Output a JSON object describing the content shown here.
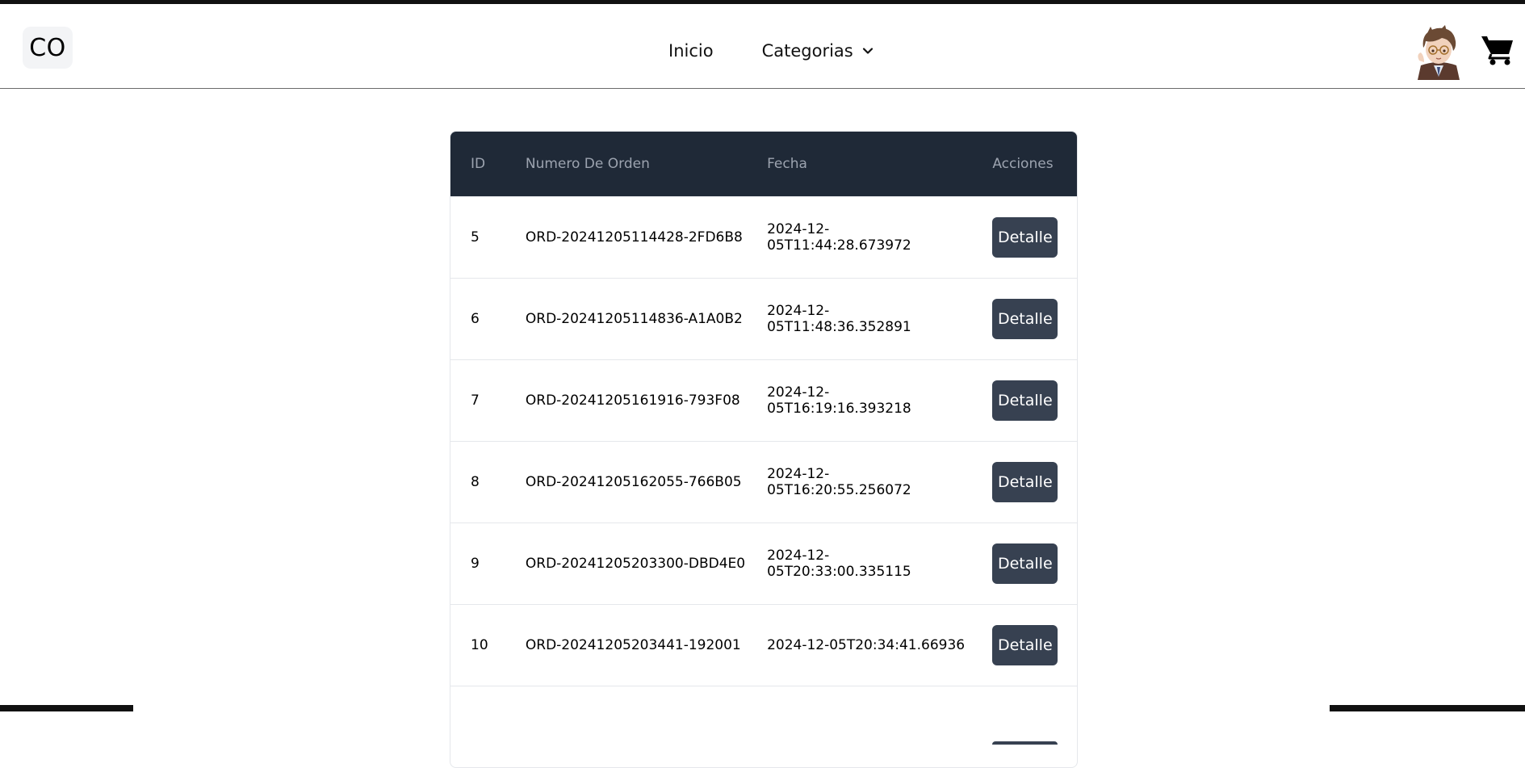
{
  "brand": {
    "logo_text": "CO"
  },
  "nav": {
    "items": [
      {
        "label": "Inicio"
      },
      {
        "label": "Categorias"
      }
    ]
  },
  "header_icons": {
    "avatar": "user-avatar",
    "cart": "shopping-cart-icon"
  },
  "table": {
    "headers": [
      "ID",
      "Numero De Orden",
      "Fecha",
      "Acciones"
    ],
    "rows": [
      {
        "id": "5",
        "numero": "ORD-20241205114428-2FD6B8",
        "fecha": "2024-12-05T11:44:28.673972",
        "accion": "Detalle"
      },
      {
        "id": "6",
        "numero": "ORD-20241205114836-A1A0B2",
        "fecha": "2024-12-05T11:48:36.352891",
        "accion": "Detalle"
      },
      {
        "id": "7",
        "numero": "ORD-20241205161916-793F08",
        "fecha": "2024-12-05T16:19:16.393218",
        "accion": "Detalle"
      },
      {
        "id": "8",
        "numero": "ORD-20241205162055-766B05",
        "fecha": "2024-12-05T16:20:55.256072",
        "accion": "Detalle"
      },
      {
        "id": "9",
        "numero": "ORD-20241205203300-DBD4E0",
        "fecha": "2024-12-05T20:33:00.335115",
        "accion": "Detalle"
      },
      {
        "id": "10",
        "numero": "ORD-20241205203441-192001",
        "fecha": "2024-12-05T20:34:41.66936",
        "accion": "Detalle"
      }
    ]
  },
  "colors": {
    "table_header_bg": "#1f2937",
    "table_header_text": "#9ca3af",
    "button_bg": "#374151",
    "button_text": "#ffffff"
  }
}
